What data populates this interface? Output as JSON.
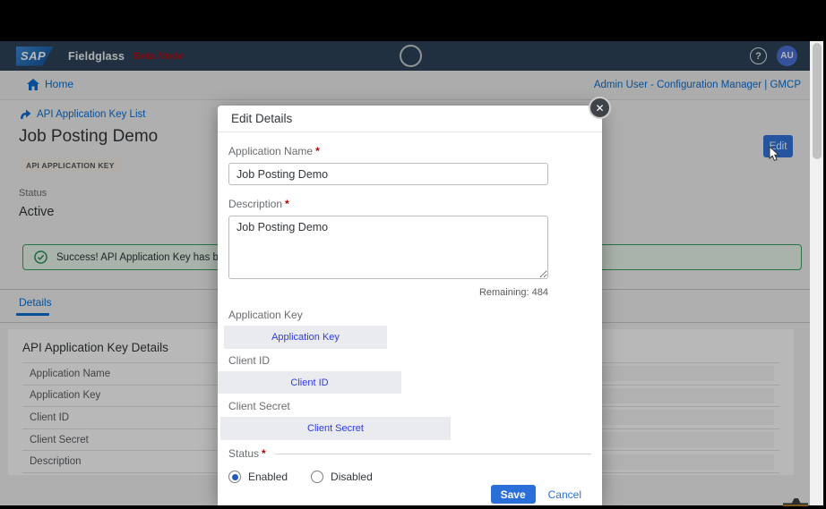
{
  "navbar": {
    "logo": "SAP",
    "product": "Fieldglass",
    "beta": "Beta Mode",
    "help_glyph": "?",
    "avatar": "AU"
  },
  "homebar": {
    "home": "Home",
    "user_context": "Admin User - Configuration Manager | GMCP"
  },
  "page": {
    "breadcrumb": "API Application Key List",
    "title": "Job Posting Demo",
    "badge": "API APPLICATION KEY",
    "status_label": "Status",
    "status_value": "Active",
    "edit_button": "Edit",
    "success_message": "Success! API Application Key has been c",
    "tab": "Details",
    "card_title": "API Application Key Details",
    "rows": [
      "Application Name",
      "Application Key",
      "Client ID",
      "Client Secret",
      "Description"
    ]
  },
  "modal": {
    "title": "Edit Details",
    "close_glyph": "✕",
    "required_mark": "*",
    "fields": {
      "app_name_label": "Application Name",
      "app_name_value": "Job Posting Demo",
      "description_label": "Description",
      "description_value": "Job Posting Demo",
      "remaining": "Remaining: 484",
      "app_key_label": "Application Key",
      "app_key_masked": "Application Key",
      "client_id_label": "Client ID",
      "client_id_masked": "Client ID",
      "client_secret_label": "Client Secret",
      "client_secret_masked": "Client Secret",
      "status_label": "Status",
      "status_options": [
        "Enabled",
        "Disabled"
      ],
      "status_selected": "Enabled"
    },
    "save": "Save",
    "cancel": "Cancel"
  },
  "colors": {
    "accent_blue": "#0a6ed1",
    "save_blue": "#2a6ed7",
    "navbar_navy": "#2f4359",
    "success_green": "#35a35f",
    "masked_text_blue": "#2b3be2",
    "beta_red": "#b00d12"
  }
}
